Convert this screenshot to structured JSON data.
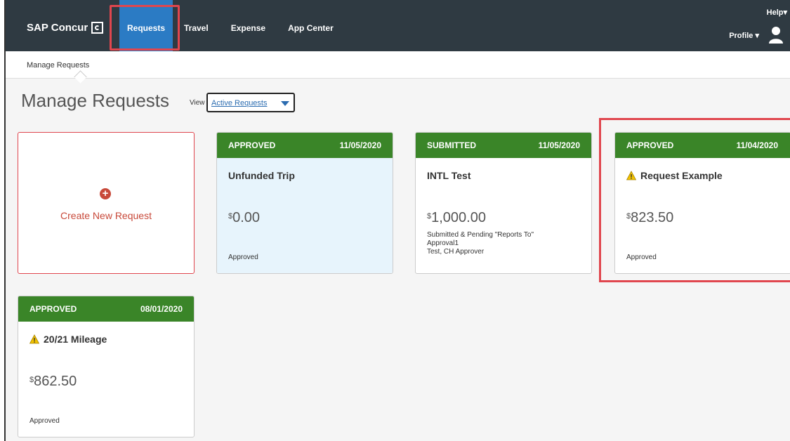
{
  "app": {
    "brand": "SAP Concur"
  },
  "nav": {
    "items": [
      {
        "label": "Requests",
        "active": true
      },
      {
        "label": "Travel"
      },
      {
        "label": "Expense"
      },
      {
        "label": "App Center"
      }
    ],
    "help": "Help▾",
    "profile": "Profile ▾"
  },
  "subnav": {
    "tab": "Manage Requests"
  },
  "page": {
    "title": "Manage Requests",
    "view_label": "View",
    "view_selected": "Active Requests"
  },
  "create": {
    "label": "Create New Request"
  },
  "cards": [
    {
      "status": "APPROVED",
      "date": "11/05/2020",
      "title": "Unfunded Trip",
      "currency": "$",
      "amount": "0.00",
      "status_text": [
        "Approved"
      ],
      "warning": false,
      "light": true
    },
    {
      "status": "SUBMITTED",
      "date": "11/05/2020",
      "title": "INTL Test",
      "currency": "$",
      "amount": "1,000.00",
      "status_text": [
        "Submitted & Pending \"Reports To\"",
        "Approval1",
        "Test, CH Approver"
      ],
      "warning": false
    },
    {
      "status": "APPROVED",
      "date": "11/04/2020",
      "title": "Request Example",
      "currency": "$",
      "amount": "823.50",
      "status_text": [
        "Approved"
      ],
      "warning": true
    },
    {
      "status": "APPROVED",
      "date": "08/01/2020",
      "title": "20/21 Mileage",
      "currency": "$",
      "amount": "862.50",
      "status_text": [
        "Approved"
      ],
      "warning": true
    }
  ],
  "colors": {
    "header_bg": "#2f3a42",
    "active_nav": "#2b7bc4",
    "approved_green": "#3a8528",
    "highlight_red": "#e0464e",
    "create_red": "#c8493a"
  }
}
